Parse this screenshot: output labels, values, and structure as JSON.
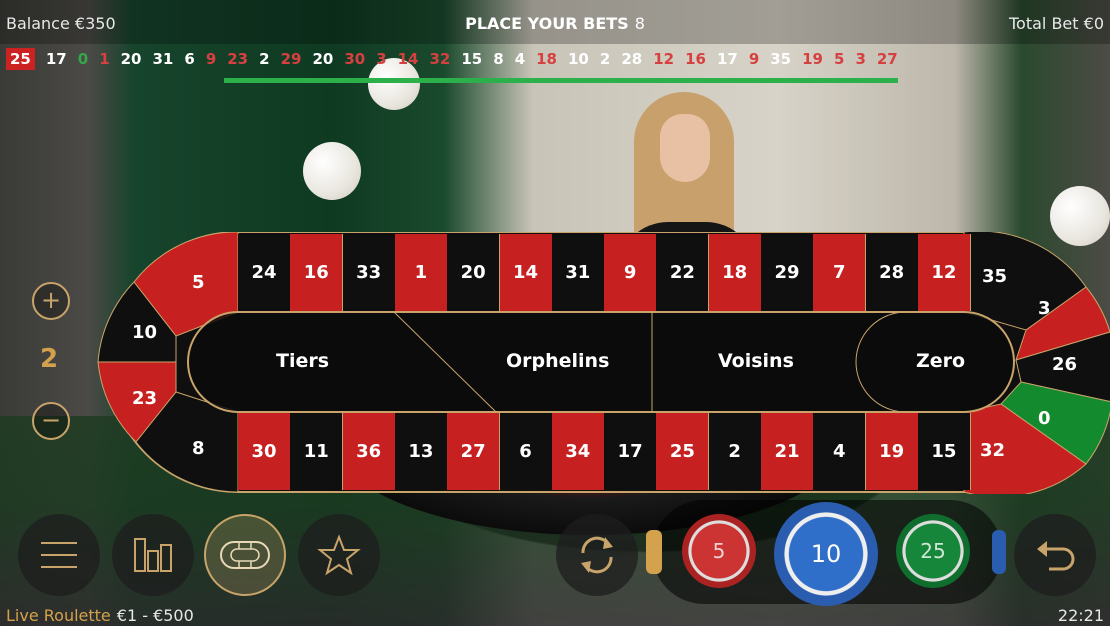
{
  "header": {
    "balance": "Balance €350",
    "status": "PLACE YOUR BETS",
    "countdown": "8",
    "total_bet": "Total Bet €0"
  },
  "history": [
    {
      "n": "25",
      "c": "red"
    },
    {
      "n": "17",
      "c": "black"
    },
    {
      "n": "0",
      "c": "green"
    },
    {
      "n": "1",
      "c": "red"
    },
    {
      "n": "20",
      "c": "black"
    },
    {
      "n": "31",
      "c": "black"
    },
    {
      "n": "6",
      "c": "black"
    },
    {
      "n": "9",
      "c": "red"
    },
    {
      "n": "23",
      "c": "red"
    },
    {
      "n": "2",
      "c": "black"
    },
    {
      "n": "29",
      "c": "red"
    },
    {
      "n": "20",
      "c": "black"
    },
    {
      "n": "30",
      "c": "red"
    },
    {
      "n": "3",
      "c": "red"
    },
    {
      "n": "14",
      "c": "red"
    },
    {
      "n": "32",
      "c": "red"
    },
    {
      "n": "15",
      "c": "black"
    },
    {
      "n": "8",
      "c": "black"
    },
    {
      "n": "4",
      "c": "black"
    },
    {
      "n": "18",
      "c": "red"
    },
    {
      "n": "10",
      "c": "black"
    },
    {
      "n": "2",
      "c": "black"
    },
    {
      "n": "28",
      "c": "black"
    },
    {
      "n": "12",
      "c": "red"
    },
    {
      "n": "16",
      "c": "red"
    },
    {
      "n": "17",
      "c": "black"
    },
    {
      "n": "9",
      "c": "red"
    },
    {
      "n": "35",
      "c": "black"
    },
    {
      "n": "19",
      "c": "red"
    },
    {
      "n": "5",
      "c": "red"
    },
    {
      "n": "3",
      "c": "red"
    },
    {
      "n": "27",
      "c": "red"
    }
  ],
  "racetrack": {
    "top_row": [
      {
        "n": "24",
        "c": "black"
      },
      {
        "n": "16",
        "c": "red"
      },
      {
        "n": "33",
        "c": "black"
      },
      {
        "n": "1",
        "c": "red"
      },
      {
        "n": "20",
        "c": "black"
      },
      {
        "n": "14",
        "c": "red"
      },
      {
        "n": "31",
        "c": "black"
      },
      {
        "n": "9",
        "c": "red"
      },
      {
        "n": "22",
        "c": "black"
      },
      {
        "n": "18",
        "c": "red"
      },
      {
        "n": "29",
        "c": "black"
      },
      {
        "n": "7",
        "c": "red"
      },
      {
        "n": "28",
        "c": "black"
      },
      {
        "n": "12",
        "c": "red"
      }
    ],
    "bottom_row": [
      {
        "n": "30",
        "c": "red"
      },
      {
        "n": "11",
        "c": "black"
      },
      {
        "n": "36",
        "c": "red"
      },
      {
        "n": "13",
        "c": "black"
      },
      {
        "n": "27",
        "c": "red"
      },
      {
        "n": "6",
        "c": "black"
      },
      {
        "n": "34",
        "c": "red"
      },
      {
        "n": "17",
        "c": "black"
      },
      {
        "n": "25",
        "c": "red"
      },
      {
        "n": "2",
        "c": "black"
      },
      {
        "n": "21",
        "c": "red"
      },
      {
        "n": "4",
        "c": "black"
      },
      {
        "n": "19",
        "c": "red"
      },
      {
        "n": "15",
        "c": "black"
      }
    ],
    "left_end": [
      "5",
      "10",
      "23",
      "8"
    ],
    "right_end": [
      "35",
      "3",
      "26",
      "0",
      "32"
    ],
    "sections": [
      "Tiers",
      "Orphelins",
      "Voisins",
      "Zero"
    ]
  },
  "zoom": {
    "value": "2"
  },
  "chips": [
    "5",
    "10",
    "25"
  ],
  "footer": {
    "game": "Live Roulette",
    "limits": "€1 - €500",
    "time": "22:21"
  },
  "colors": {
    "red": "#c62020",
    "black": "#0f0f0f",
    "green": "#138a2e",
    "gold": "#c8a46a",
    "timer": "#2bb04a"
  }
}
